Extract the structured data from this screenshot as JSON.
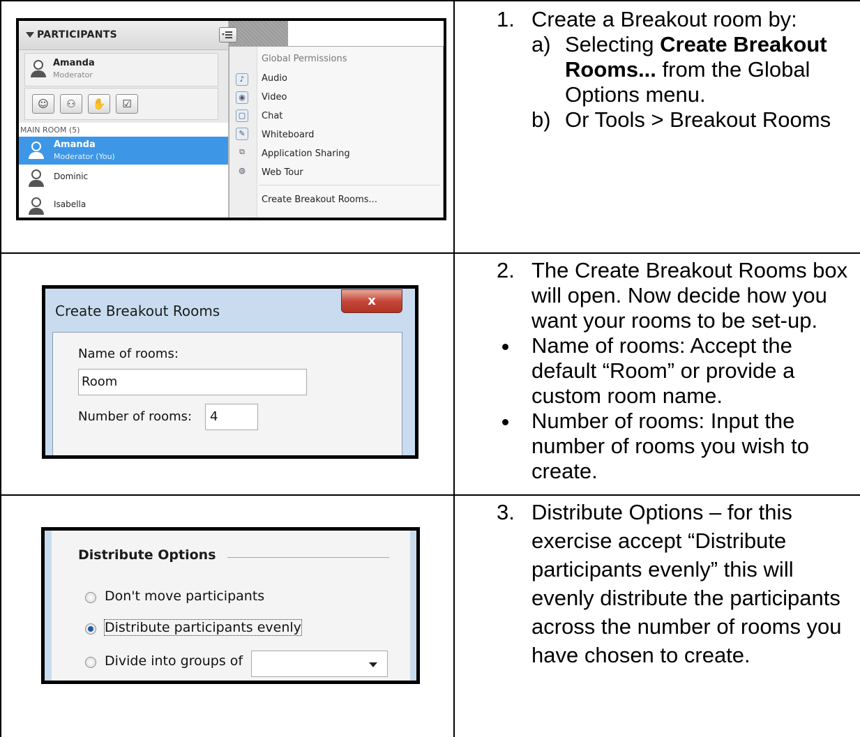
{
  "step1": {
    "number": "1.",
    "text": "Create a Breakout room by:",
    "sub_a": {
      "letter": "a)",
      "prefix": "Selecting ",
      "bold": "Create Breakout Rooms...",
      "suffix": " from the Global Options menu."
    },
    "sub_b": {
      "letter": "b)",
      "text": "Or Tools > Breakout Rooms"
    }
  },
  "step2": {
    "number": "2.",
    "text": "The Create Breakout Rooms box will open.  Now decide how you want your rooms to be set-up.",
    "bullets": [
      "Name of rooms: Accept the default “Room” or provide a custom room name.",
      "Number of rooms: Input the number of rooms you wish to create."
    ]
  },
  "step3": {
    "number": "3.",
    "text": "Distribute Options – for this exercise accept “Distribute participants evenly” this will evenly distribute the participants across the number of rooms you have chosen to create."
  },
  "participants_panel": {
    "header": "PARTICIPANTS",
    "current_user": {
      "name": "Amanda",
      "role": "Moderator"
    },
    "section_label": "MAIN ROOM (5)",
    "participants": [
      {
        "name": "Amanda",
        "role": "Moderator (You)",
        "selected": true
      },
      {
        "name": "Dominic",
        "role": "",
        "selected": false
      },
      {
        "name": "Isabella",
        "role": "",
        "selected": false
      }
    ],
    "tool_icons": [
      "emoticon-icon",
      "profile-icon",
      "raise-hand-icon",
      "poll-icon"
    ]
  },
  "global_menu": {
    "title": "Global Permissions",
    "items": [
      "Audio",
      "Video",
      "Chat",
      "Whiteboard",
      "Application Sharing",
      "Web Tour"
    ],
    "action": "Create Breakout Rooms..."
  },
  "breakout_dialog": {
    "title": "Create Breakout Rooms",
    "close_label": "x",
    "name_label": "Name of rooms:",
    "name_value": "Room",
    "number_label": "Number of rooms:",
    "number_value": "4"
  },
  "distribute_options": {
    "title": "Distribute Options",
    "options": [
      "Don't move participants",
      "Distribute participants evenly",
      "Divide into groups of"
    ],
    "selected_index": 1,
    "group_size_value": ""
  }
}
